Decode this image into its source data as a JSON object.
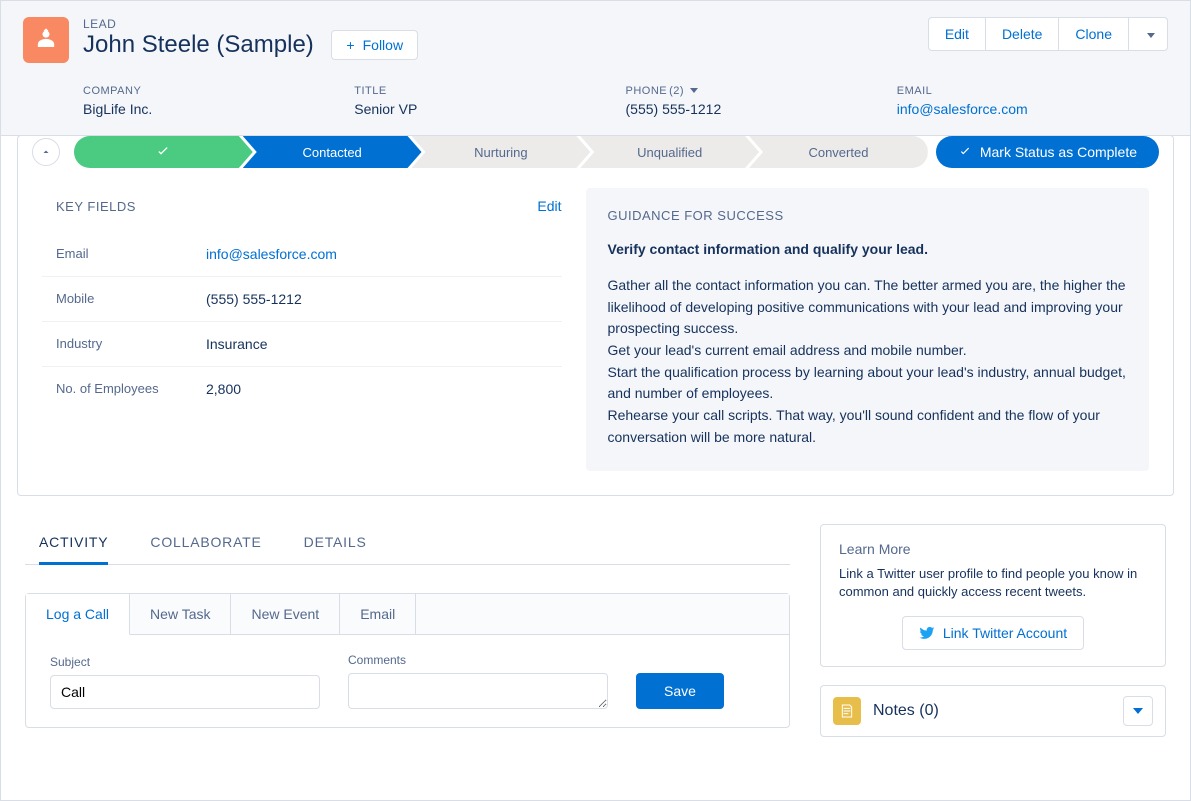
{
  "header": {
    "object_label": "LEAD",
    "name": "John Steele (Sample)",
    "follow_label": "Follow",
    "actions": {
      "edit": "Edit",
      "delete": "Delete",
      "clone": "Clone"
    }
  },
  "summary": {
    "company": {
      "label": "COMPANY",
      "value": "BigLife Inc."
    },
    "title": {
      "label": "TITLE",
      "value": "Senior VP"
    },
    "phone": {
      "label": "PHONE",
      "count": "(2)",
      "value": "(555) 555-1212"
    },
    "email": {
      "label": "EMAIL",
      "value": "info@salesforce.com"
    }
  },
  "path": {
    "steps": [
      "",
      "Contacted",
      "Nurturing",
      "Unqualified",
      "Converted"
    ],
    "complete_label": "Mark Status as Complete"
  },
  "key_fields": {
    "title": "KEY FIELDS",
    "edit": "Edit",
    "rows": [
      {
        "label": "Email",
        "value": "info@salesforce.com",
        "link": true
      },
      {
        "label": "Mobile",
        "value": "(555) 555-1212"
      },
      {
        "label": "Industry",
        "value": "Insurance"
      },
      {
        "label": "No. of Employees",
        "value": "2,800"
      }
    ]
  },
  "guidance": {
    "title": "GUIDANCE FOR SUCCESS",
    "verify": "Verify contact information and qualify your lead.",
    "body": "Gather all the contact information you can. The better armed you are, the higher the likelihood of developing positive communications with your lead and improving your prospecting success.\nGet your lead's current email address and mobile number.\nStart the qualification process by learning about your lead's industry, annual budget, and number of employees.\nRehearse your call scripts. That way, you'll sound confident and the flow of your conversation will be more natural."
  },
  "tabs": {
    "activity": "ACTIVITY",
    "collaborate": "COLLABORATE",
    "details": "DETAILS"
  },
  "activity": {
    "subtabs": {
      "log_call": "Log a Call",
      "new_task": "New Task",
      "new_event": "New Event",
      "email": "Email"
    },
    "subject_label": "Subject",
    "subject_value": "Call",
    "comments_label": "Comments",
    "save": "Save"
  },
  "learn": {
    "title": "Learn More",
    "body": "Link a Twitter user profile to find people you know in common and quickly access recent tweets.",
    "button": "Link Twitter Account"
  },
  "notes": {
    "title": "Notes (0)"
  }
}
